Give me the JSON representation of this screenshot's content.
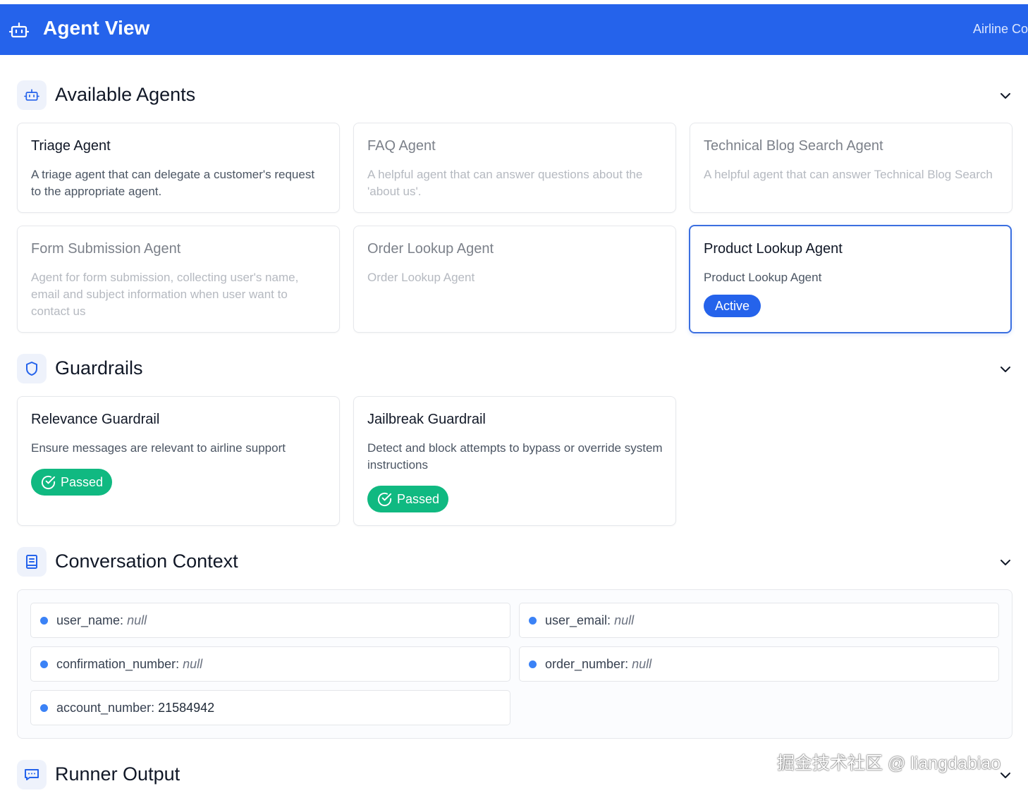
{
  "header": {
    "title": "Agent View",
    "right_text": "Airline Co"
  },
  "sections": {
    "agents_title": "Available Agents",
    "guardrails_title": "Guardrails",
    "context_title": "Conversation Context",
    "runner_title": "Runner Output"
  },
  "agents": [
    {
      "name": "Triage Agent",
      "description": "A triage agent that can delegate a customer's request to the appropriate agent."
    },
    {
      "name": "FAQ Agent",
      "description": "A helpful agent that can answer questions about the 'about us'."
    },
    {
      "name": "Technical Blog Search Agent",
      "description": "A helpful agent that can answer Technical Blog Search"
    },
    {
      "name": "Form Submission Agent",
      "description": "Agent for form submission, collecting user's name, email and subject information when user want to contact us"
    },
    {
      "name": "Order Lookup Agent",
      "description": "Order Lookup Agent"
    },
    {
      "name": "Product Lookup Agent",
      "description": "Product Lookup Agent",
      "badge": "Active"
    }
  ],
  "guardrails": [
    {
      "name": "Relevance Guardrail",
      "description": "Ensure messages are relevant to airline support",
      "status": "Passed"
    },
    {
      "name": "Jailbreak Guardrail",
      "description": "Detect and block attempts to bypass or override system instructions",
      "status": "Passed"
    }
  ],
  "context": [
    {
      "key": "user_name:",
      "value": "null"
    },
    {
      "key": "user_email:",
      "value": "null"
    },
    {
      "key": "confirmation_number:",
      "value": "null"
    },
    {
      "key": "order_number:",
      "value": "null"
    },
    {
      "key": "account_number:",
      "value": "21584942"
    }
  ],
  "watermark": "掘金技术社区 @ liangdabiao",
  "colors": {
    "header": "#2563eb",
    "active": "#2563eb",
    "passed": "#10b981",
    "dot": "#3b82f6"
  }
}
